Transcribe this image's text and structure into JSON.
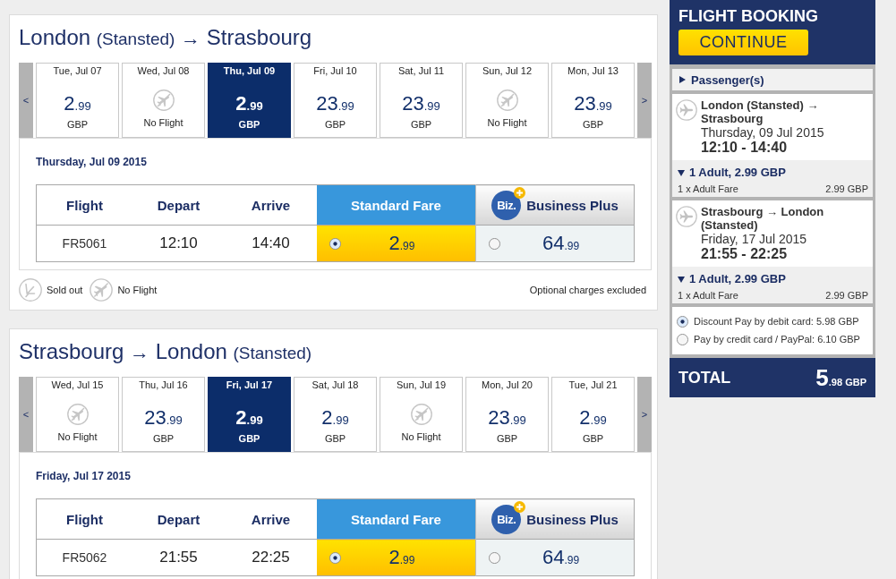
{
  "journeys": [
    {
      "title": [
        {
          "kind": "place",
          "text": "London"
        },
        {
          "kind": "note",
          "text": "(Stansted)"
        },
        {
          "kind": "arrow",
          "text": "→"
        },
        {
          "kind": "place",
          "text": "Strasbourg"
        }
      ],
      "prev": "<",
      "next": ">",
      "dates": [
        {
          "kind": "price",
          "day": "Tue, Jul 07",
          "whole": "2",
          "cents": ".99",
          "currency": "GBP",
          "selected": false
        },
        {
          "kind": "no_flight",
          "day": "Wed, Jul 08",
          "label": "No Flight",
          "selected": false
        },
        {
          "kind": "price",
          "day": "Thu, Jul 09",
          "whole": "2",
          "cents": ".99",
          "currency": "GBP",
          "selected": true
        },
        {
          "kind": "price",
          "day": "Fri, Jul 10",
          "whole": "23",
          "cents": ".99",
          "currency": "GBP",
          "selected": false
        },
        {
          "kind": "price",
          "day": "Sat, Jul 11",
          "whole": "23",
          "cents": ".99",
          "currency": "GBP",
          "selected": false
        },
        {
          "kind": "no_flight",
          "day": "Sun, Jul 12",
          "label": "No Flight",
          "selected": false
        },
        {
          "kind": "price",
          "day": "Mon, Jul 13",
          "whole": "23",
          "cents": ".99",
          "currency": "GBP",
          "selected": false
        }
      ],
      "heading": "Thursday, Jul 09 2015",
      "table": {
        "columns": [
          "Flight",
          "Depart",
          "Arrive"
        ],
        "fares": [
          {
            "kind": "standard",
            "label": "Standard Fare"
          },
          {
            "kind": "business",
            "badge": "Biz.",
            "label": "Business Plus"
          }
        ],
        "rows": [
          {
            "flight": "FR5061",
            "depart": "12:10",
            "arrive": "14:40",
            "prices": [
              {
                "whole": "2",
                "cents": ".99",
                "selected": true
              },
              {
                "whole": "64",
                "cents": ".99",
                "selected": false
              }
            ]
          }
        ]
      },
      "legend": [
        {
          "kind": "sold_out",
          "label": "Sold out"
        },
        {
          "kind": "no_flight",
          "label": "No Flight"
        }
      ],
      "note": "Optional charges excluded"
    },
    {
      "title": [
        {
          "kind": "place",
          "text": "Strasbourg"
        },
        {
          "kind": "arrow",
          "text": "→"
        },
        {
          "kind": "place",
          "text": "London"
        },
        {
          "kind": "note",
          "text": "(Stansted)"
        }
      ],
      "prev": "<",
      "next": ">",
      "dates": [
        {
          "kind": "no_flight",
          "day": "Wed, Jul 15",
          "label": "No Flight",
          "selected": false
        },
        {
          "kind": "price",
          "day": "Thu, Jul 16",
          "whole": "23",
          "cents": ".99",
          "currency": "GBP",
          "selected": false
        },
        {
          "kind": "price",
          "day": "Fri, Jul 17",
          "whole": "2",
          "cents": ".99",
          "currency": "GBP",
          "selected": true
        },
        {
          "kind": "price",
          "day": "Sat, Jul 18",
          "whole": "2",
          "cents": ".99",
          "currency": "GBP",
          "selected": false
        },
        {
          "kind": "no_flight",
          "day": "Sun, Jul 19",
          "label": "No Flight",
          "selected": false
        },
        {
          "kind": "price",
          "day": "Mon, Jul 20",
          "whole": "23",
          "cents": ".99",
          "currency": "GBP",
          "selected": false
        },
        {
          "kind": "price",
          "day": "Tue, Jul 21",
          "whole": "2",
          "cents": ".99",
          "currency": "GBP",
          "selected": false
        }
      ],
      "heading": "Friday, Jul 17 2015",
      "table": {
        "columns": [
          "Flight",
          "Depart",
          "Arrive"
        ],
        "fares": [
          {
            "kind": "standard",
            "label": "Standard Fare"
          },
          {
            "kind": "business",
            "badge": "Biz.",
            "label": "Business Plus"
          }
        ],
        "rows": [
          {
            "flight": "FR5062",
            "depart": "21:55",
            "arrive": "22:25",
            "prices": [
              {
                "whole": "2",
                "cents": ".99",
                "selected": true
              },
              {
                "whole": "64",
                "cents": ".99",
                "selected": false
              }
            ]
          }
        ]
      }
    }
  ],
  "booking": {
    "title": "FLIGHT BOOKING",
    "button": "CONTINUE",
    "passengers": {
      "label": "Passenger(s)",
      "expanded": false
    },
    "flights": [
      {
        "route": "London (Stansted) → Strasbourg",
        "date": "Thursday, 09 Jul 2015",
        "time": "12:10 - 14:40",
        "fare": {
          "label": "1 Adult, 2.99 GBP",
          "expanded": true,
          "item": "1 x Adult Fare",
          "amount": "2.99 GBP"
        }
      },
      {
        "route": "Strasbourg → London (Stansted)",
        "date": "Friday, 17 Jul 2015",
        "time": "21:55 - 22:25",
        "fare": {
          "label": "1 Adult, 2.99 GBP",
          "expanded": true,
          "item": "1 x Adult Fare",
          "amount": "2.99 GBP"
        }
      }
    ],
    "payment": [
      {
        "label": "Discount Pay by debit card: 5.98 GBP",
        "selected": true
      },
      {
        "label": "Pay by credit card / PayPal: 6.10 GBP",
        "selected": false
      }
    ],
    "total": {
      "label": "TOTAL",
      "whole": "5",
      "cents": ".98",
      "currency": "GBP"
    }
  }
}
